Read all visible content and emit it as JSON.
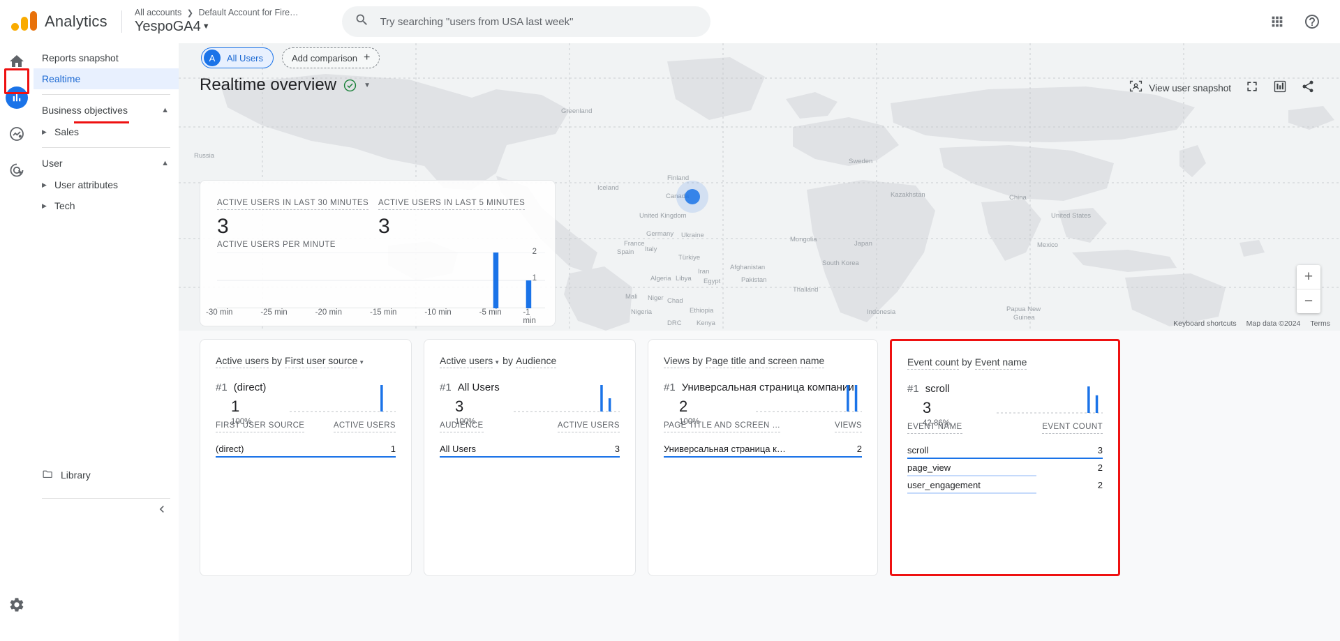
{
  "topbar": {
    "brand": "Analytics",
    "account_path_root": "All accounts",
    "account_path_child": "Default Account for Fire…",
    "property_name": "YespoGA4",
    "search_placeholder": "Try searching \"users from USA last week\"",
    "apps_icon": "grid-apps-icon",
    "help_icon": "help-circle-icon",
    "search_icon": "search-icon"
  },
  "rail": {
    "items": [
      {
        "name": "home",
        "icon": "home-icon",
        "selected": false
      },
      {
        "name": "reports",
        "icon": "bar-chart-icon",
        "selected": true
      },
      {
        "name": "explore",
        "icon": "explore-trend-icon",
        "selected": false
      },
      {
        "name": "advertising",
        "icon": "advertising-target-icon",
        "selected": false
      }
    ],
    "settings_icon": "gear-icon",
    "highlight_color": "#ee1111"
  },
  "sidebar": {
    "items": [
      {
        "label": "Reports snapshot",
        "type": "item",
        "selected": false
      },
      {
        "label": "Realtime",
        "type": "item",
        "selected": true
      }
    ],
    "groups": [
      {
        "header": "Business objectives",
        "expanded": true,
        "children": [
          {
            "label": "Sales"
          }
        ]
      },
      {
        "header": "User",
        "expanded": true,
        "children": [
          {
            "label": "User attributes"
          },
          {
            "label": "Tech"
          }
        ]
      }
    ],
    "library_label": "Library",
    "library_icon": "folder-icon",
    "collapse_icon": "chevron-left-icon",
    "expand_icon": "chevron-up-icon",
    "child_arrow_icon": "triangle-right-icon"
  },
  "controls": {
    "segment_initial": "A",
    "segment_label": "All Users",
    "add_comparison_label": "Add comparison",
    "add_comparison_icon": "plus-icon"
  },
  "header": {
    "title": "Realtime overview",
    "badge_icon": "check-circle-icon",
    "badge_color": "#188038",
    "caret_icon": "chevron-down-icon"
  },
  "toolbar": {
    "user_snapshot_label": "View user snapshot",
    "user_snapshot_icon": "user-snapshot-icon",
    "fullscreen_icon": "fullscreen-icon",
    "compare_icon": "compare-columns-icon",
    "share_icon": "share-icon"
  },
  "map": {
    "zoom_in_label": "+",
    "zoom_out_label": "−",
    "keyboard_shortcuts": "Keyboard shortcuts",
    "map_data": "Map data ©2024",
    "terms": "Terms",
    "marker_color": "#1a73e8"
  },
  "realtime_card": {
    "metric_30min_label": "ACTIVE USERS IN LAST 30 MINUTES",
    "metric_30min_value": "3",
    "metric_5min_label": "ACTIVE USERS IN LAST 5 MINUTES",
    "metric_5min_value": "3",
    "per_minute_label": "ACTIVE USERS PER MINUTE"
  },
  "chart_data": {
    "type": "bar",
    "title": "ACTIVE USERS PER MINUTE",
    "xlabel": "",
    "ylabel": "",
    "ylim": [
      0,
      2
    ],
    "yticks": [
      "1",
      "2"
    ],
    "grid": true,
    "bar_color": "#1a73e8",
    "categories": [
      "-30 min",
      "-29 min",
      "-28 min",
      "-27 min",
      "-26 min",
      "-25 min",
      "-24 min",
      "-23 min",
      "-22 min",
      "-21 min",
      "-20 min",
      "-19 min",
      "-18 min",
      "-17 min",
      "-16 min",
      "-15 min",
      "-14 min",
      "-13 min",
      "-12 min",
      "-11 min",
      "-10 min",
      "-9 min",
      "-8 min",
      "-7 min",
      "-6 min",
      "-5 min",
      "-4 min",
      "-3 min",
      "-2 min",
      "-1 min"
    ],
    "values": [
      0,
      0,
      0,
      0,
      0,
      0,
      0,
      0,
      0,
      0,
      0,
      0,
      0,
      0,
      0,
      0,
      0,
      0,
      0,
      0,
      0,
      0,
      0,
      0,
      0,
      2,
      0,
      0,
      1,
      0
    ],
    "xtick_labels": [
      "-30 min",
      "-25 min",
      "-20 min",
      "-15 min",
      "-10 min",
      "-5 min",
      "-1 min"
    ]
  },
  "cards": [
    {
      "metric": "Active users",
      "by": "by",
      "dimension": "First user source",
      "dimension_has_caret": true,
      "metric_has_caret": false,
      "rank": "#1",
      "rank_value": "(direct)",
      "big_value": "1",
      "percent": "100%",
      "col_dimension": "FIRST USER SOURCE",
      "col_metric": "ACTIVE USERS",
      "spark_values": [
        0,
        0,
        0,
        0,
        0,
        0,
        0,
        0,
        0,
        0,
        0,
        0,
        0,
        0,
        0,
        0,
        0,
        0,
        0,
        0,
        0,
        0,
        1,
        0,
        0,
        0
      ],
      "rows": [
        {
          "name": "(direct)",
          "value": "1",
          "bar_pct": 100
        }
      ],
      "highlighted": false
    },
    {
      "metric": "Active users",
      "by": "by",
      "dimension": "Audience",
      "dimension_has_caret": false,
      "metric_has_caret": true,
      "rank": "#1",
      "rank_value": "All Users",
      "big_value": "3",
      "percent": "100%",
      "col_dimension": "AUDIENCE",
      "col_metric": "ACTIVE USERS",
      "spark_values": [
        0,
        0,
        0,
        0,
        0,
        0,
        0,
        0,
        0,
        0,
        0,
        0,
        0,
        0,
        0,
        0,
        0,
        0,
        0,
        0,
        0,
        2,
        0,
        1,
        0,
        0
      ],
      "rows": [
        {
          "name": "All Users",
          "value": "3",
          "bar_pct": 100
        }
      ],
      "highlighted": false
    },
    {
      "metric": "Views",
      "by": "by",
      "dimension": "Page title and screen name",
      "dimension_has_caret": false,
      "metric_has_caret": false,
      "rank": "#1",
      "rank_value": "Универсальная страница компании",
      "big_value": "2",
      "percent": "100%",
      "col_dimension": "PAGE TITLE AND SCREEN …",
      "col_metric": "VIEWS",
      "spark_values": [
        0,
        0,
        0,
        0,
        0,
        0,
        0,
        0,
        0,
        0,
        0,
        0,
        0,
        0,
        0,
        0,
        0,
        0,
        0,
        0,
        0,
        0,
        2,
        0,
        2,
        0
      ],
      "rows": [
        {
          "name": "Универсальная страница к…",
          "value": "2",
          "bar_pct": 100
        }
      ],
      "highlighted": false
    },
    {
      "metric": "Event count",
      "by": "by",
      "dimension": "Event name",
      "dimension_has_caret": false,
      "metric_has_caret": false,
      "rank": "#1",
      "rank_value": "scroll",
      "big_value": "3",
      "percent": "42.86%",
      "col_dimension": "EVENT NAME",
      "col_metric": "EVENT COUNT",
      "spark_values": [
        0,
        0,
        0,
        0,
        0,
        0,
        0,
        0,
        0,
        0,
        0,
        0,
        0,
        0,
        0,
        0,
        0,
        0,
        0,
        0,
        0,
        0,
        3,
        0,
        2,
        0
      ],
      "rows": [
        {
          "name": "scroll",
          "value": "3",
          "bar_pct": 100
        },
        {
          "name": "page_view",
          "value": "2",
          "bar_pct": 66
        },
        {
          "name": "user_engagement",
          "value": "2",
          "bar_pct": 66
        }
      ],
      "highlighted": true
    }
  ]
}
